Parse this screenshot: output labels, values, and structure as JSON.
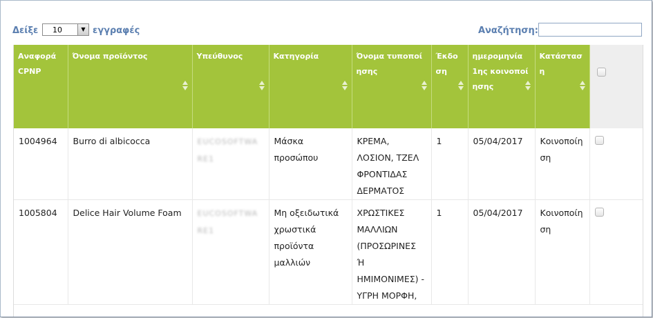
{
  "length_menu": {
    "label_before": "Δείξε",
    "value": "10",
    "label_after": "εγγραφές"
  },
  "search": {
    "label": "Αναζήτηση:",
    "value": ""
  },
  "columns": [
    "Αναφορά CPNP",
    "Όνομα προϊόντος",
    "Υπεύθυνος",
    "Κατηγορία",
    "Όνομα τυποποίησης",
    "Έκδοση",
    "ημερομηνία 1ης κοινοποίησης",
    "Κατάσταση"
  ],
  "rows": [
    {
      "cpnp": "1004964",
      "name": "Burro di albicocca",
      "responsible": "EUCOSOFTWARE1",
      "category": "Μάσκα προσώπου",
      "formulation": "ΚΡΕΜΑ, ΛΟΣΙΟΝ, ΤΖΕΛ ΦΡΟΝΤΙΔΑΣ ΔΕΡΜΑΤΟΣ",
      "version": "1",
      "date": "05/04/2017",
      "status": "Κοινοποίηση"
    },
    {
      "cpnp": "1005804",
      "name": "Delice Hair Volume Foam",
      "responsible": "EUCOSOFTWARE1",
      "category": "Μη οξειδωτικά χρωστικά προϊόντα μαλλιών",
      "formulation": "ΧΡΩΣΤΙΚΕΣ ΜΑΛΛΙΩΝ (ΠΡΟΣΩΡΙΝΕΣ Ή ΗΜΙΜΟΝΙΜΕΣ) - ΥΓΡΗ ΜΟΡΦΗ,",
      "version": "1",
      "date": "05/04/2017",
      "status": "Κοινοποίηση"
    }
  ]
}
